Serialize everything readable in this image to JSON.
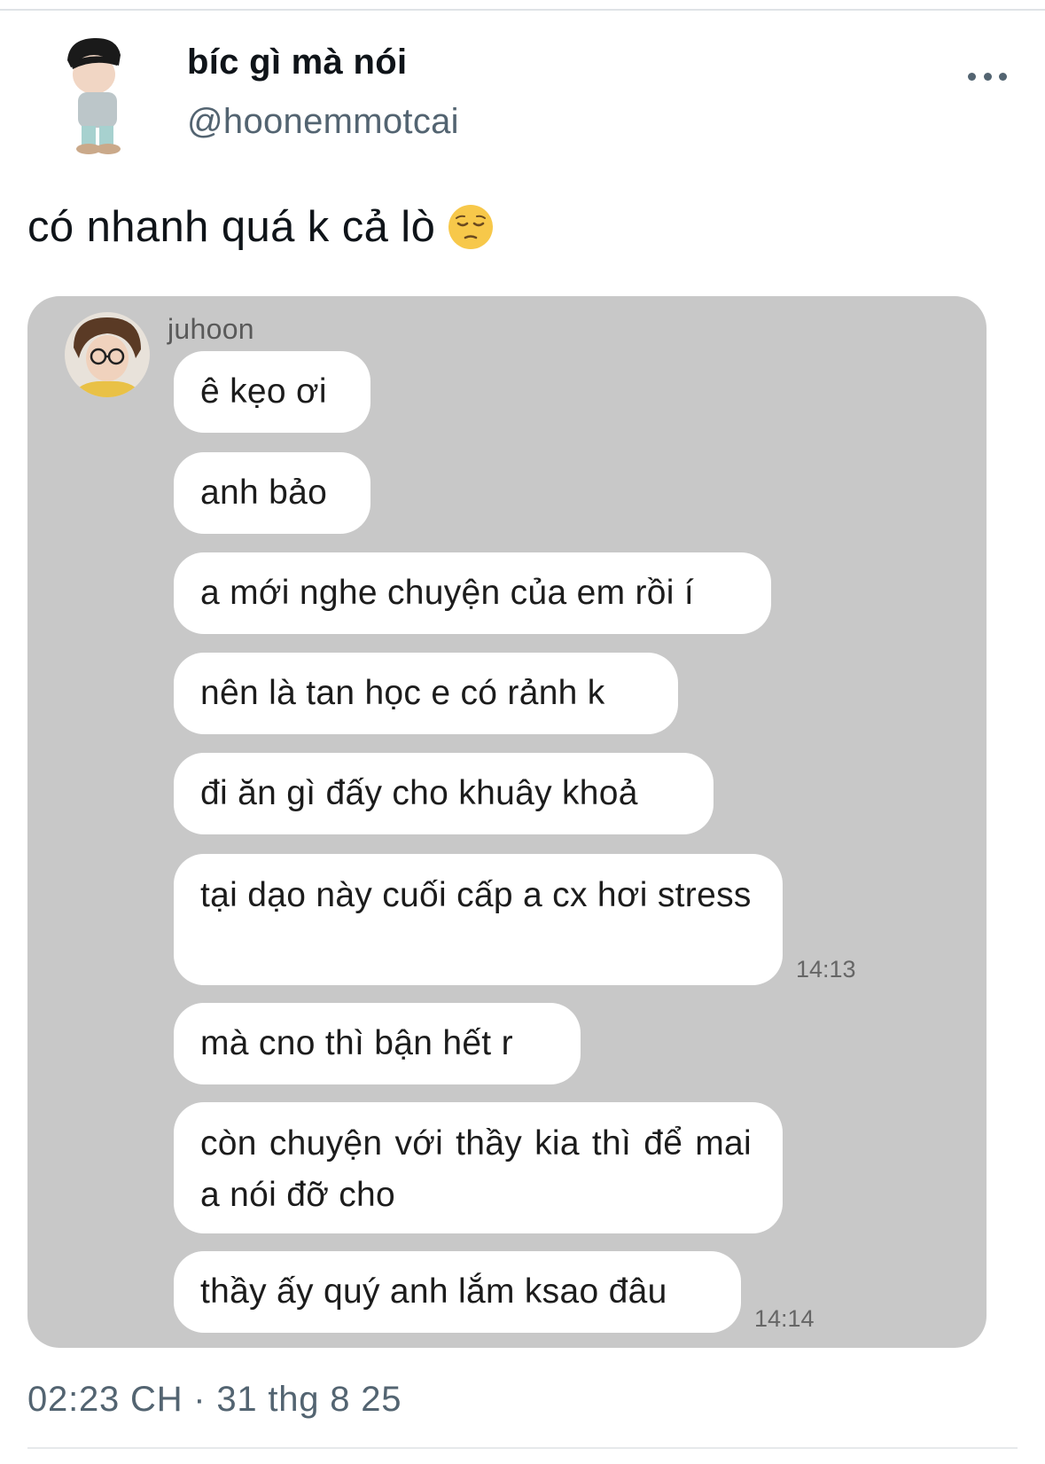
{
  "author": {
    "display_name": "bíc gì mà nói",
    "handle": "@hoonemmotcai",
    "avatar_icon": "cartoon-boy-avatar-icon"
  },
  "tweet": {
    "text": "có nhanh quá k cả lò",
    "emoji": "pensive-face-emoji"
  },
  "chat": {
    "sender": "juhoon",
    "avatar_icon": "juhoon-avatar-icon",
    "background": "#c8c8c8",
    "messages": [
      {
        "text": "ê kẹo ơi",
        "time": ""
      },
      {
        "text": "anh bảo",
        "time": ""
      },
      {
        "text": "a mới nghe chuyện của em rồi í",
        "time": ""
      },
      {
        "text": "nên là tan học e có rảnh k",
        "time": ""
      },
      {
        "text": "đi ăn gì đấy cho khuây khoả",
        "time": ""
      },
      {
        "text": "tại dạo này cuối cấp a cx hơi stress",
        "time": "14:13"
      },
      {
        "text": "mà cno thì bận hết r",
        "time": ""
      },
      {
        "text": "còn chuyện với thầy kia thì để mai a nói đỡ cho",
        "time": ""
      },
      {
        "text": "thầy ấy quý anh lắm ksao đâu",
        "time": "14:14"
      }
    ]
  },
  "meta": {
    "timestamp": "02:23 CH · 31 thg 8 25"
  },
  "colors": {
    "primary_text": "#0f1419",
    "secondary_text": "#536471",
    "bubble": "#ffffff"
  }
}
